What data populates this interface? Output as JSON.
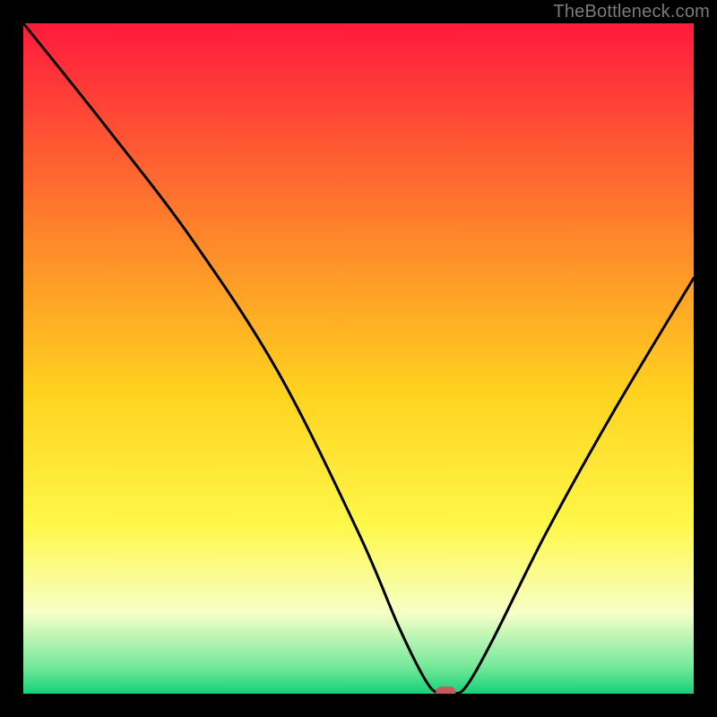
{
  "watermark": "TheBottleneck.com",
  "chart_data": {
    "type": "line",
    "title": "",
    "xlabel": "",
    "ylabel": "",
    "xlim": [
      0,
      100
    ],
    "ylim": [
      0,
      100
    ],
    "grid": false,
    "series": [
      {
        "name": "bottleneck-curve",
        "x": [
          0,
          12,
          25,
          38,
          50,
          56,
          60,
          62,
          64,
          66,
          70,
          78,
          88,
          100
        ],
        "values": [
          100,
          85,
          68,
          48,
          24,
          10,
          2,
          0,
          0,
          1,
          8,
          24,
          42,
          62
        ]
      }
    ],
    "marker": {
      "x": 63,
      "y": 0
    },
    "gradient_stops": [
      {
        "offset": 0,
        "color": "#ff1a3e"
      },
      {
        "offset": 33,
        "color": "#ff8a2a"
      },
      {
        "offset": 55,
        "color": "#ffd21f"
      },
      {
        "offset": 75,
        "color": "#fff84a"
      },
      {
        "offset": 88,
        "color": "#f6ffc8"
      },
      {
        "offset": 96,
        "color": "#74e89a"
      },
      {
        "offset": 100,
        "color": "#14d17a"
      }
    ]
  }
}
